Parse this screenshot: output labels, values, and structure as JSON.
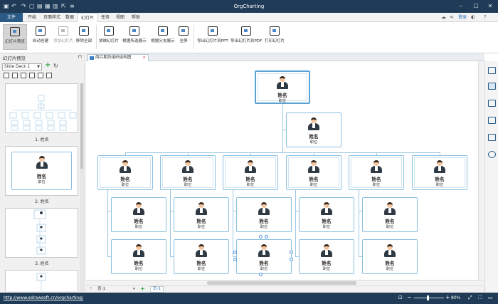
{
  "app": {
    "title": "OrgCharting",
    "login": "登录"
  },
  "menu": [
    "文件",
    "开始",
    "页面样式",
    "数据",
    "幻灯片",
    "任务",
    "视图",
    "帮助"
  ],
  "ribbon": [
    "幻灯片预览",
    "自动创建",
    "添加幻灯片",
    "移除全部",
    "放映幻灯片",
    "根据所选展示",
    "根据分支展示",
    "全屏",
    "导出幻灯片到PPT",
    "导出幻灯片到PDF",
    "打印幻灯片"
  ],
  "pane": {
    "title": "幻灯片预览",
    "deck": "Slide Deck 1",
    "slides": [
      "1. 姓名",
      "2. 姓名",
      "3. 姓名"
    ],
    "mini_name": "姓名",
    "mini_role": "职位"
  },
  "tab": {
    "label": "两片期员组织结构图"
  },
  "node": {
    "name": "姓名",
    "role": "职位"
  },
  "pagebar": {
    "page1": "页-1",
    "page2": "页-1"
  },
  "status": {
    "url": "http://www.edrawsoft.cn/orgcharting/",
    "zoom": "80%"
  },
  "colors": {
    "titlebar": "#1f3b57",
    "accent": "#2c5a87",
    "node_border": "#8cc0e2"
  }
}
